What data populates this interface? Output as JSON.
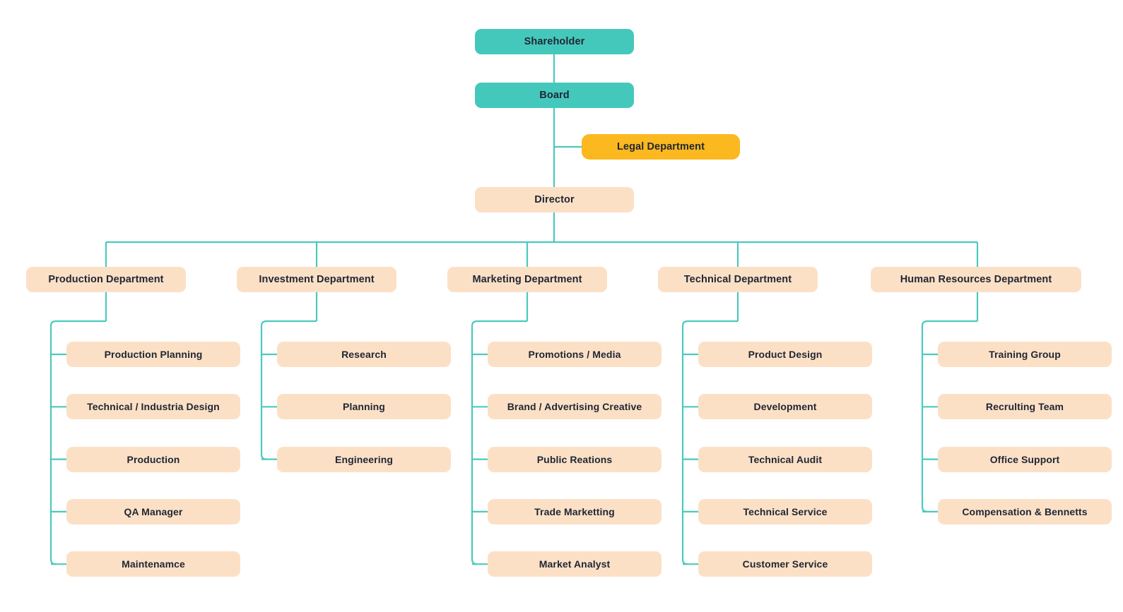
{
  "diagram": {
    "title": "Organizational Chart",
    "palette": {
      "teal": "#45c8bc",
      "orange": "#fbb81f",
      "peach": "#fce0c6",
      "connector": "#4cc9bd",
      "text": "#1f2633",
      "background": "#ffffff"
    }
  },
  "top": {
    "shareholder": "Shareholder",
    "board": "Board",
    "legal": "Legal  Department",
    "director": "Director"
  },
  "departments": [
    {
      "label": "Production Department",
      "children": [
        "Production Planning",
        "Technical / Industria Design",
        "Production",
        "QA Manager",
        "Maintenamce"
      ]
    },
    {
      "label": "Investment Department",
      "children": [
        "Research",
        "Planning",
        "Engineering"
      ]
    },
    {
      "label": "Marketing Department",
      "children": [
        "Promotions / Media",
        "Brand / Advertising Creative",
        "Public Reations",
        "Trade Marketting",
        "Market Analyst"
      ]
    },
    {
      "label": "Technical Department",
      "children": [
        "Product Design",
        "Development",
        "Technical Audit",
        "Technical Service",
        "Customer Service"
      ]
    },
    {
      "label": "Human Resources Department",
      "children": [
        "Training Group",
        "Recrulting Team",
        "Office Support",
        "Compensation & Bennetts"
      ]
    }
  ]
}
